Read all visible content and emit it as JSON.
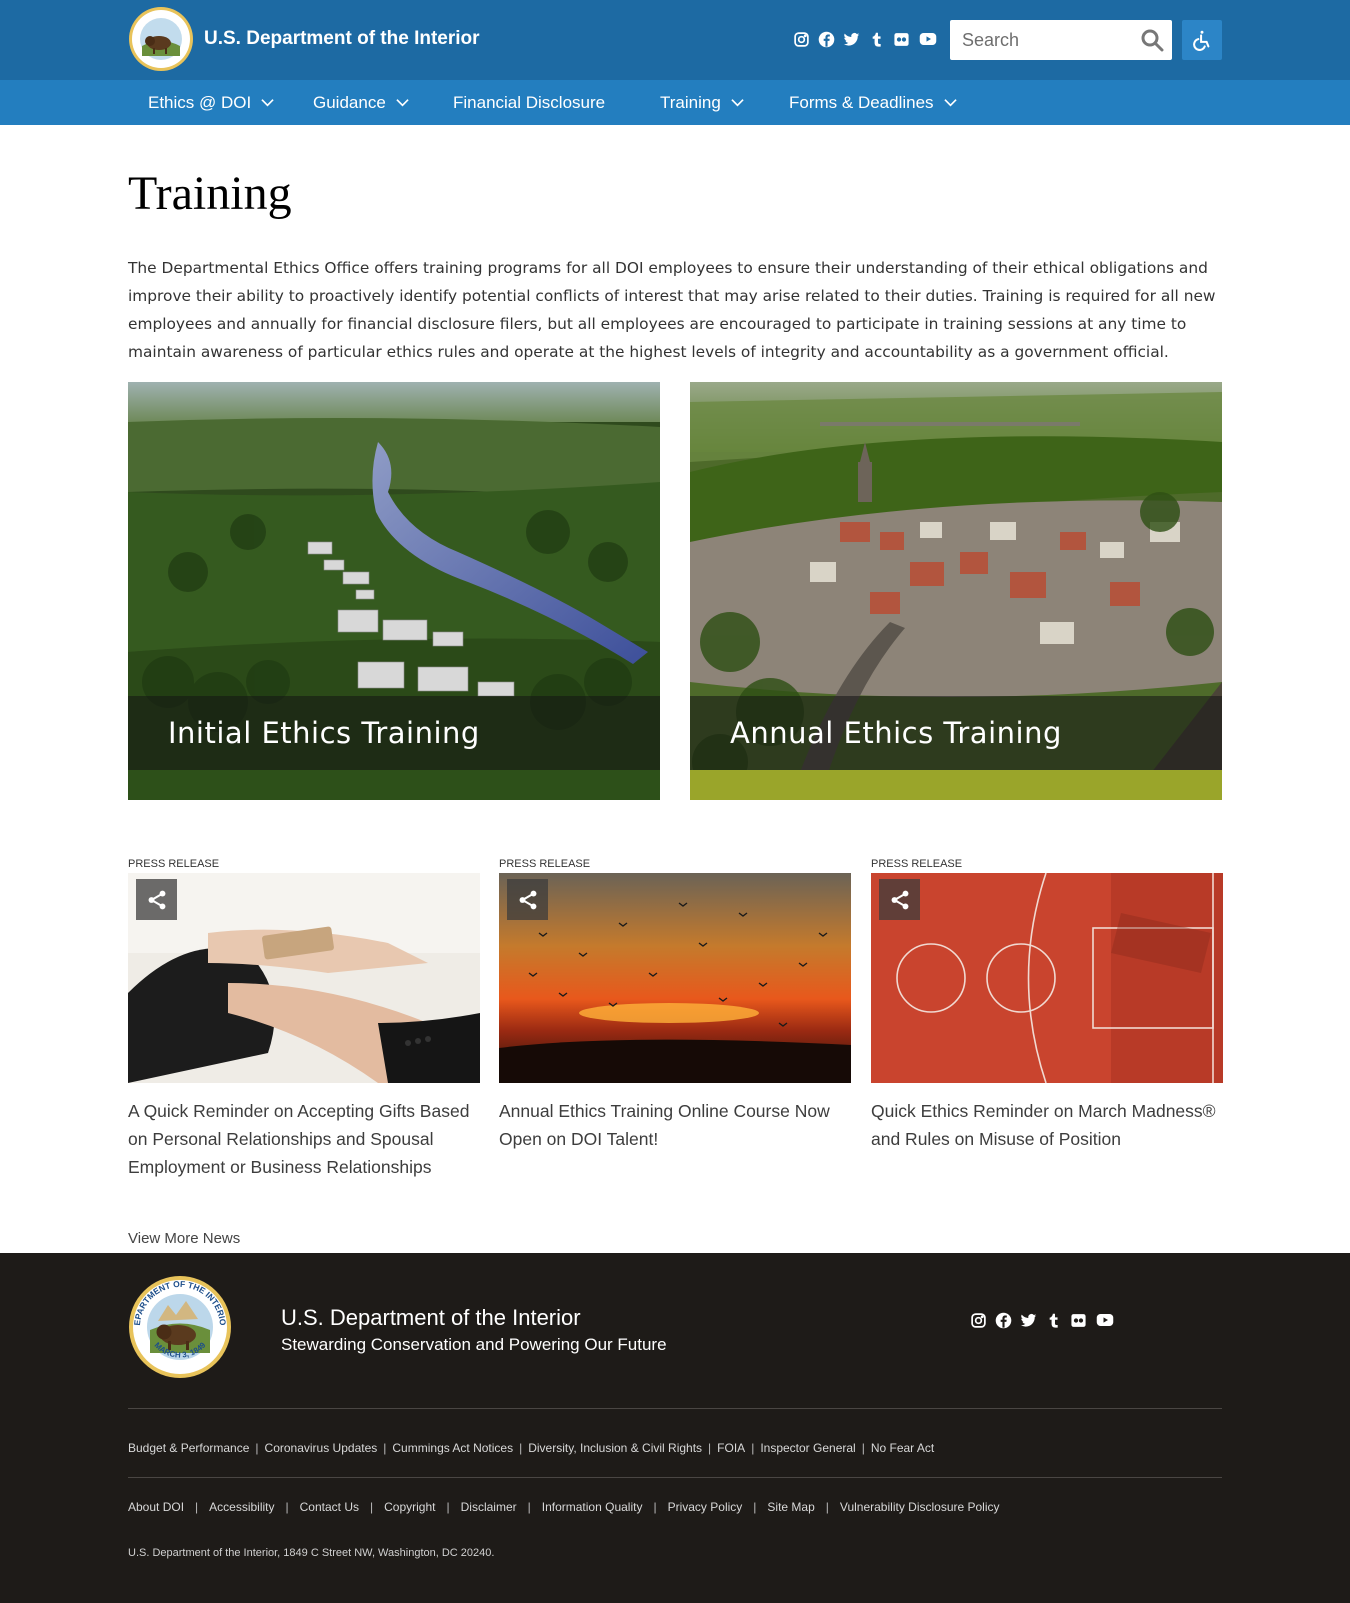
{
  "header": {
    "org_name": "U.S. Department of the Interior",
    "social_icons": [
      "instagram-icon",
      "facebook-icon",
      "twitter-icon",
      "tumblr-icon",
      "flickr-icon",
      "youtube-icon"
    ],
    "search_placeholder": "Search",
    "accessibility_icon": "accessibility-icon"
  },
  "nav": {
    "items": [
      {
        "label": "Ethics @ DOI",
        "has_dropdown": true
      },
      {
        "label": "Guidance",
        "has_dropdown": true
      },
      {
        "label": "Financial Disclosure",
        "has_dropdown": false
      },
      {
        "label": "Training",
        "has_dropdown": true
      },
      {
        "label": "Forms & Deadlines",
        "has_dropdown": true
      }
    ]
  },
  "main": {
    "title": "Training",
    "intro": "The Departmental Ethics Office offers training programs for all DOI employees to ensure their understanding of their ethical obligations and improve their ability to proactively identify potential conflicts of interest that may arise related to their duties.  Training is required for all new employees and annually for financial disclosure filers, but all employees are encouraged to participate in training sessions at any time to maintain awareness of particular ethics rules and operate at the highest levels of integrity and accountability as a government official.",
    "cards": [
      {
        "title": "Initial Ethics Training"
      },
      {
        "title": "Annual Ethics Training"
      }
    ],
    "news": [
      {
        "category": "Press Release",
        "title": "A Quick Reminder on Accepting Gifts Based on Personal Relationships and Spousal Employment or Business Relationships"
      },
      {
        "category": "Press Release",
        "title": "Annual Ethics Training Online Course Now Open on DOI Talent!"
      },
      {
        "category": "Press Release",
        "title": "Quick Ethics Reminder on March Madness® and Rules on Misuse of Position"
      }
    ],
    "view_more": "View More News"
  },
  "footer": {
    "org_name": "U.S. Department of the Interior",
    "tagline": "Stewarding Conservation and Powering Our Future",
    "links_row1": [
      "Budget & Performance",
      "Coronavirus Updates",
      "Cummings Act Notices",
      "Diversity, Inclusion & Civil Rights",
      "FOIA",
      "Inspector General",
      "No Fear Act"
    ],
    "links_row2": [
      "About DOI",
      "Accessibility",
      "Contact Us",
      "Copyright",
      "Disclaimer",
      "Information Quality",
      "Privacy Policy",
      "Site Map",
      "Vulnerability Disclosure Policy"
    ],
    "address": "U.S. Department of the Interior, 1849 C Street NW, Washington, DC 20240.",
    "seal_text_top": "DEPARTMENT OF THE INTERIOR",
    "seal_text_bottom": "MARCH 3, 1849"
  },
  "colors": {
    "header_bg": "#1d6aa3",
    "nav_bg": "#237ebf",
    "footer_bg": "#1e1b18"
  }
}
